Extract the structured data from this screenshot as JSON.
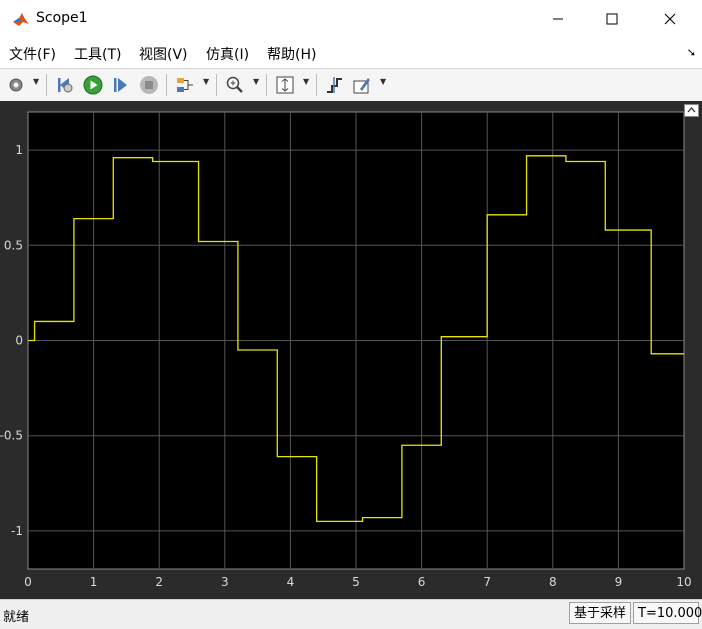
{
  "window": {
    "title": "Scope1"
  },
  "menu": [
    "文件(F)",
    "工具(T)",
    "视图(V)",
    "仿真(I)",
    "帮助(H)"
  ],
  "toolbar_icons": [
    "settings-icon",
    "step-back-icon",
    "run-icon",
    "step-forward-icon",
    "stop-icon",
    "trigger-icon",
    "zoom-icon",
    "scale-axes-icon",
    "cursor-measure-icon",
    "highlight-icon"
  ],
  "status": {
    "left": "就绪",
    "mode": "基于采样",
    "time": "T=10.000"
  },
  "colors": {
    "plot_bg": "#000000",
    "frame_bg": "#2b2b2b",
    "signal": "#e6e600",
    "grid": "#555555"
  },
  "chart_data": {
    "type": "line",
    "step": true,
    "x": [
      0,
      0.1,
      0.7,
      1.3,
      1.9,
      2.6,
      3.2,
      3.8,
      4.4,
      5.1,
      5.7,
      6.3,
      7.0,
      7.6,
      8.2,
      8.8,
      9.5,
      10
    ],
    "y": [
      0,
      0.1,
      0.64,
      0.96,
      0.94,
      0.52,
      -0.05,
      -0.61,
      -0.95,
      -0.93,
      -0.55,
      0.02,
      0.66,
      0.97,
      0.94,
      0.58,
      -0.07,
      -0.07
    ],
    "xlim": [
      0,
      10
    ],
    "ylim": [
      -1.2,
      1.2
    ],
    "xticks": [
      "0",
      "1",
      "2",
      "3",
      "4",
      "5",
      "6",
      "7",
      "8",
      "9",
      "10"
    ],
    "yticks": [
      "1",
      "0.5",
      "0",
      "-0.5",
      "-1"
    ],
    "ytick_values": [
      1,
      0.5,
      0,
      -0.5,
      -1
    ],
    "grid": true
  }
}
